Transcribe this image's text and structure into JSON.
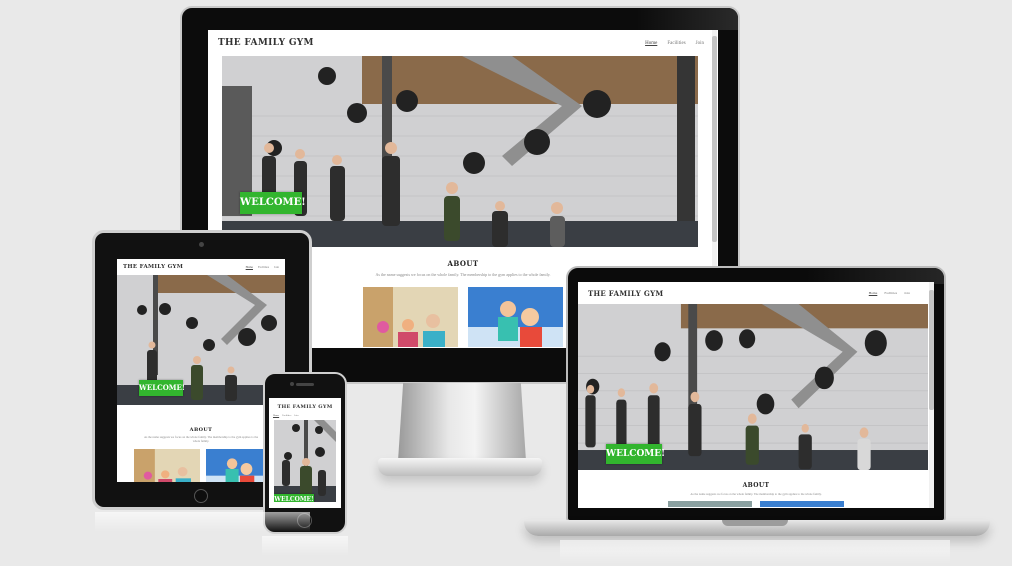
{
  "site": {
    "brand": "THE FAMILY GYM",
    "nav": [
      "Home",
      "Facilities",
      "Join"
    ],
    "welcome": "WELCOME!",
    "about_title": "ABOUT",
    "about_text": "As the name suggests we focus on the whole family. The membership to the gym applies to the whole family."
  },
  "colors": {
    "background": "#e9e9e9",
    "welcome_green": "#32b52e",
    "device_black": "#0c0c0c",
    "wall": "#cfcfcf",
    "floor": "#3a3e44"
  },
  "devices": [
    "desktop-monitor",
    "tablet",
    "phone",
    "laptop"
  ]
}
